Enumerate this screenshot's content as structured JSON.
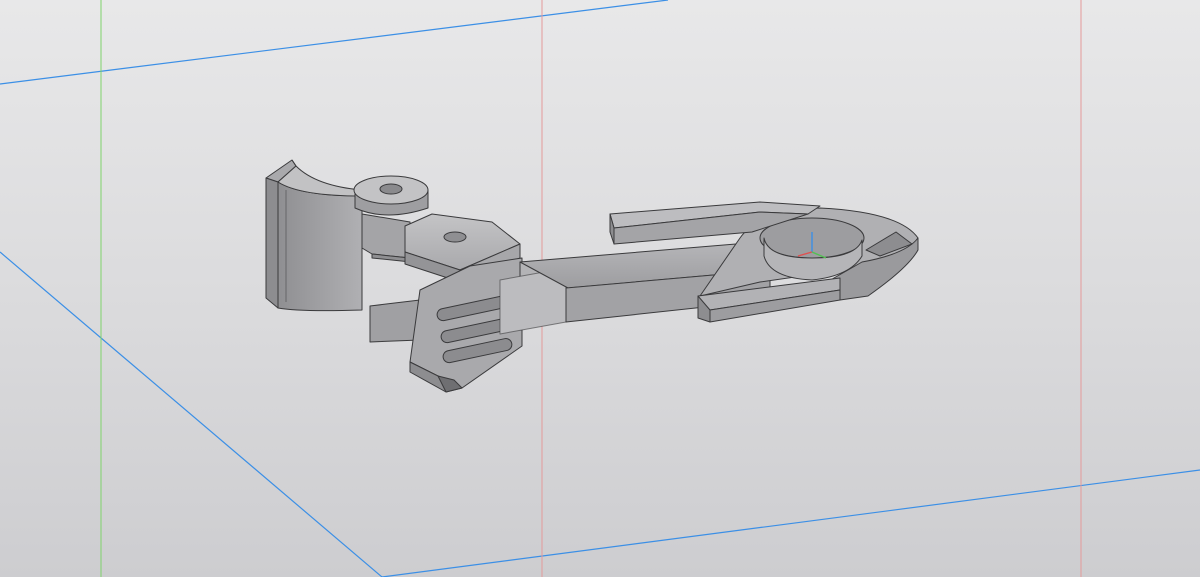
{
  "viewport": {
    "background_top": "#e8e8e9",
    "background_bottom": "#cdcdd0",
    "grid_plane_color": "#3b8fe6",
    "vertical_axis_color": "#e08b8b",
    "green_axis_color": "#7fd36b",
    "model_face_light": "#b9b9bb",
    "model_face_mid": "#a2a2a5",
    "model_face_dark": "#8a8a8d",
    "model_edge": "#3a3a3c"
  },
  "origin_triad": {
    "icon": "axis-triad-icon",
    "x_color": "#e05050",
    "y_color": "#52c052",
    "z_color": "#3b8fe6"
  },
  "model": {
    "icon": "3d-part-model"
  }
}
